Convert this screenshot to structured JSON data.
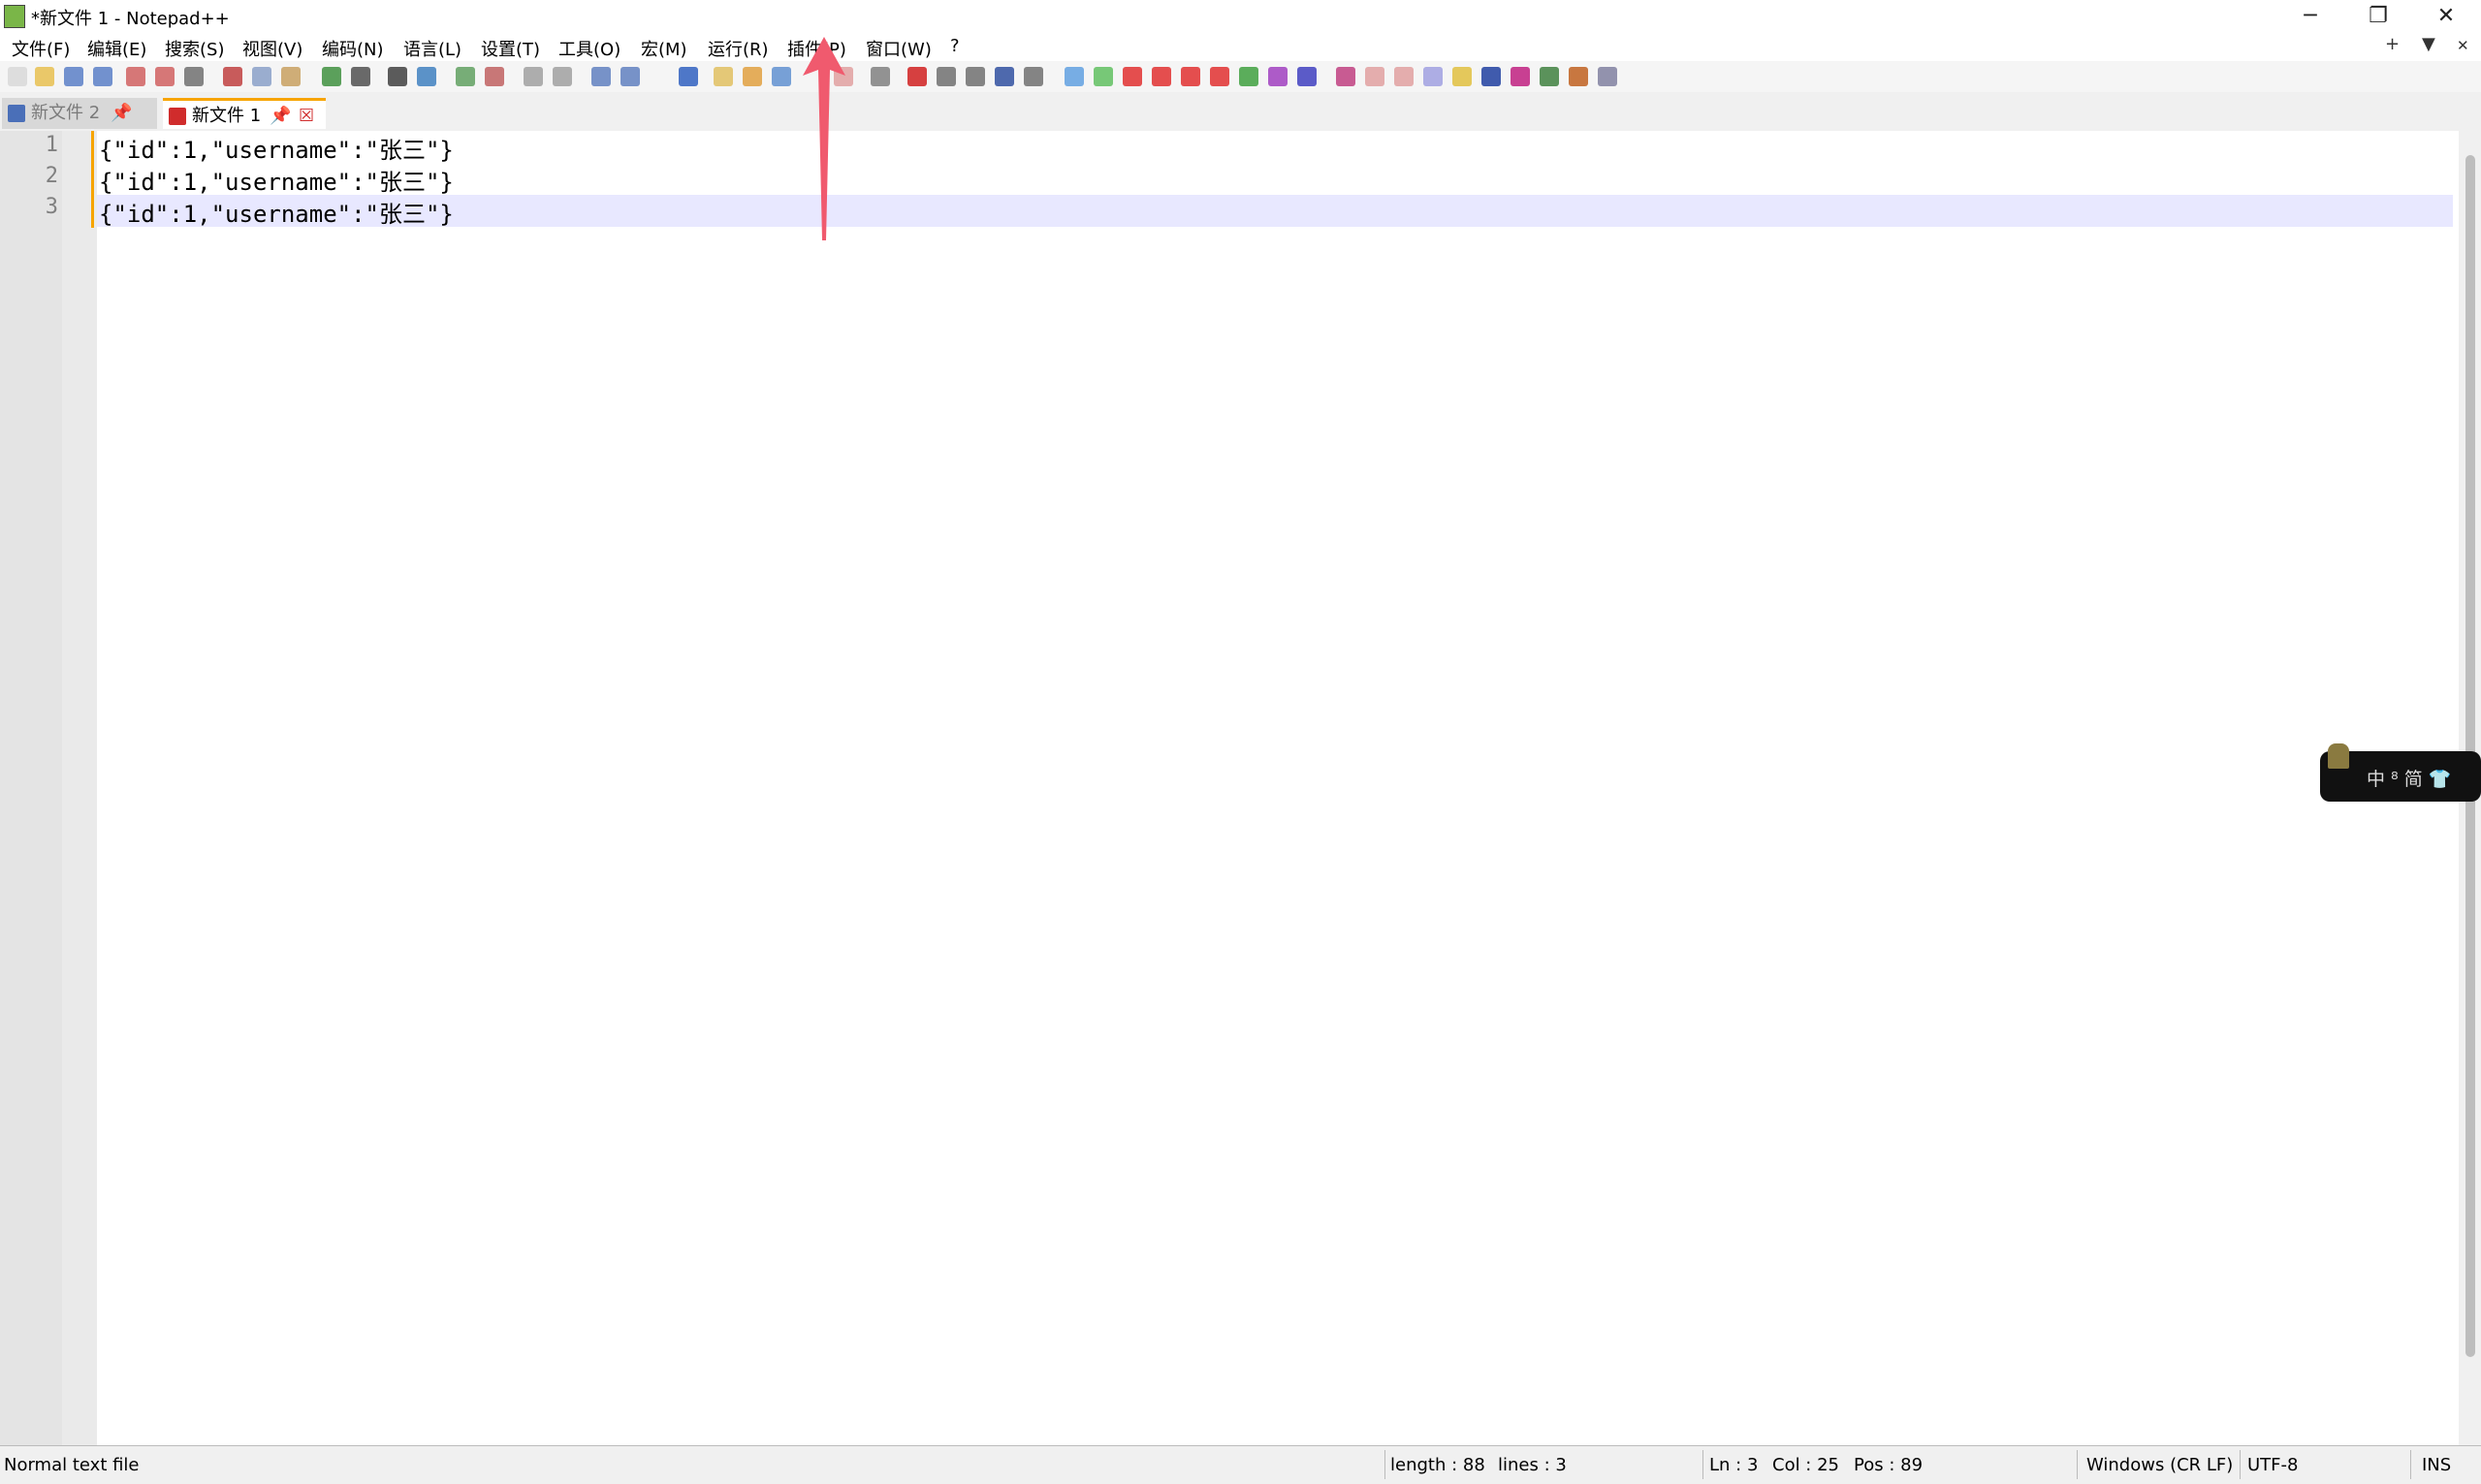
{
  "window": {
    "title": "*新文件 1 - Notepad++",
    "minimize": "─",
    "restore": "❐",
    "close": "✕"
  },
  "menu": [
    "文件(F)",
    "编辑(E)",
    "搜索(S)",
    "视图(V)",
    "编码(N)",
    "语言(L)",
    "设置(T)",
    "工具(O)",
    "宏(M)",
    "运行(R)",
    "插件(P)",
    "窗口(W)",
    "?"
  ],
  "menu_right": [
    "+",
    "▼",
    "✕"
  ],
  "tabs": [
    {
      "label": "新文件 2",
      "pin": "📌",
      "active": false
    },
    {
      "label": "新文件 1",
      "pin": "📌",
      "close": "☒",
      "active": true
    }
  ],
  "lines": [
    {
      "num": "1",
      "text": "{\"id\":1,\"username\":\"张三\"}"
    },
    {
      "num": "2",
      "text": "{\"id\":1,\"username\":\"张三\"}"
    },
    {
      "num": "3",
      "text": "{\"id\":1,\"username\":\"张三\"}"
    }
  ],
  "ime": {
    "label": "中 ⁸ 简 👕"
  },
  "status": {
    "type": "Normal text file",
    "length": "length : 88",
    "lines": "lines : 3",
    "ln": "Ln : 3",
    "col": "Col : 25",
    "pos": "Pos : 89",
    "eol": "Windows (CR LF)",
    "enc": "UTF-8",
    "mode": "INS"
  },
  "colors": {
    "accent": "#e8304b",
    "current_line": "#e8e8ff",
    "active_tab_top": "#f7a400"
  }
}
